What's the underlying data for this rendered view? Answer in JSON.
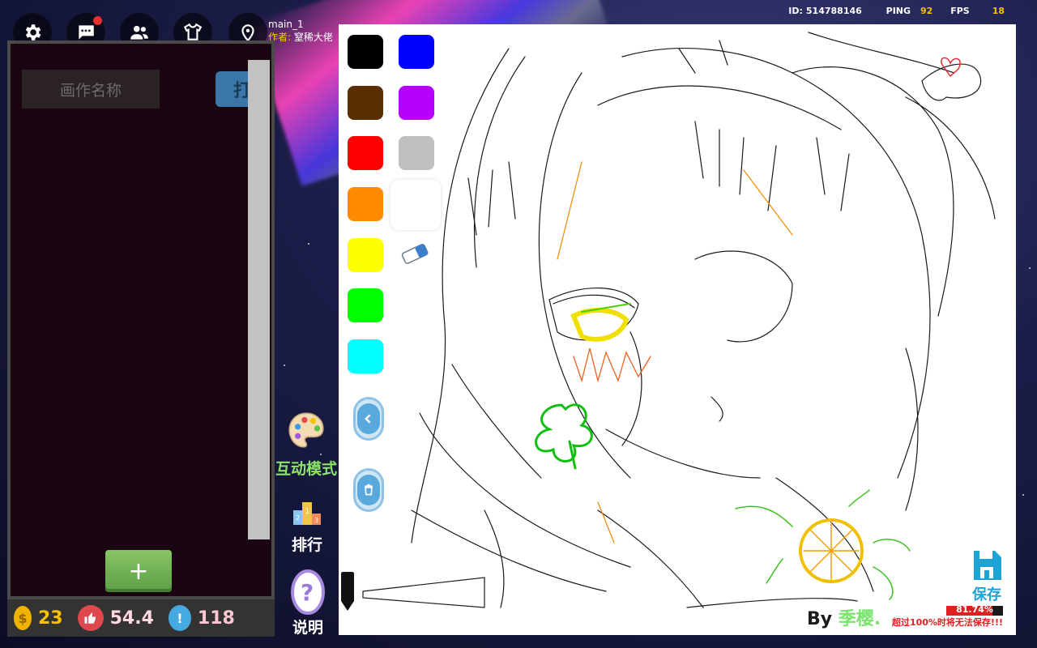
{
  "top_toolbar": {
    "buttons": [
      {
        "icon": "gear-icon"
      },
      {
        "icon": "chat-icon",
        "notification": true
      },
      {
        "icon": "friends-icon"
      },
      {
        "icon": "shirt-icon"
      },
      {
        "icon": "map-pin-icon"
      }
    ],
    "map_name": "main_1",
    "author_label": "作者:",
    "author_name": "窒稀大佬"
  },
  "stats": {
    "id_label": "ID:",
    "id_value": "514788146",
    "ping_label": "PING",
    "ping_value": "92",
    "fps_label": "FPS",
    "fps_value": "18"
  },
  "left_panel": {
    "name_placeholder": "画作名称",
    "open_label": "打",
    "add_label": "+",
    "coins": "23",
    "likes": "54.4",
    "info_count": "118"
  },
  "side_buttons": {
    "interactive_mode_label": "互动模式",
    "ranking_label": "排行",
    "help_label": "说明"
  },
  "palette": {
    "colors": [
      "#000000",
      "#5b2e04",
      "#fe0000",
      "#fe8a00",
      "#ffff00",
      "#00ff00",
      "#00ffff",
      "#0000ff",
      "#b800ff",
      "#bfbfbf",
      "#ffffff"
    ],
    "selected": "#ffffff"
  },
  "canvas": {
    "signature_prefix": "By",
    "signature_name": "季樱.",
    "save_label": "保存",
    "progress_text": "81.74%",
    "progress_value": 0.8174,
    "warning_text": "超过100%时将无法保存!!!"
  }
}
